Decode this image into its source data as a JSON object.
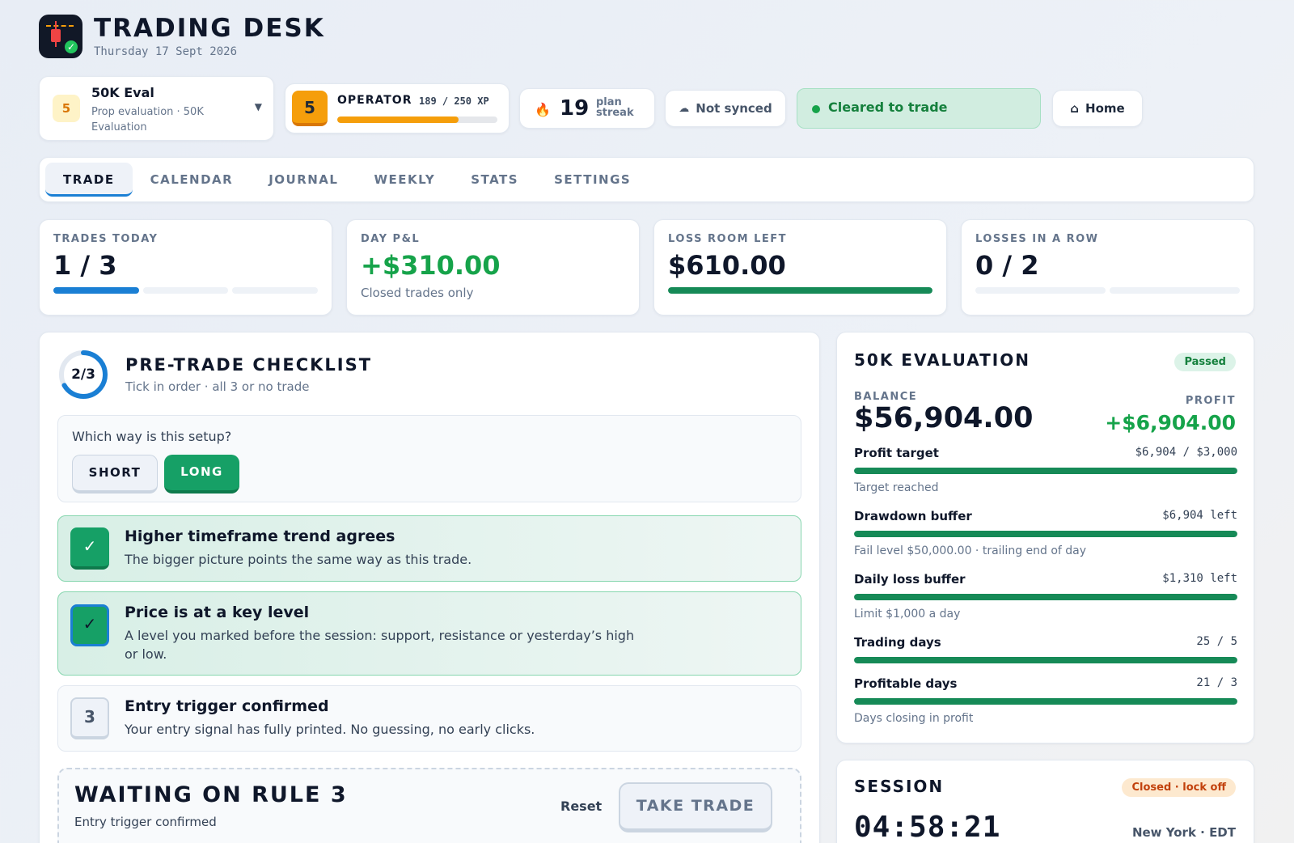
{
  "app": {
    "title": "TRADING DESK",
    "date": "Thursday 17 Sept 2026"
  },
  "account": {
    "badge": "5",
    "name": "50K Eval",
    "subtitle": "Prop evaluation · 50K Evaluation"
  },
  "operator": {
    "level": "5",
    "rank": "OPERATOR",
    "xp_text": "189 / 250 XP",
    "xp_progress": 0.756
  },
  "streak": {
    "count": "19",
    "label": "plan streak"
  },
  "sync": {
    "label": "Not synced"
  },
  "status": {
    "label": "Cleared to trade"
  },
  "home": {
    "label": "Home"
  },
  "tabs": [
    {
      "label": "TRADE",
      "active": true
    },
    {
      "label": "CALENDAR",
      "active": false
    },
    {
      "label": "JOURNAL",
      "active": false
    },
    {
      "label": "WEEKLY",
      "active": false
    },
    {
      "label": "STATS",
      "active": false
    },
    {
      "label": "SETTINGS",
      "active": false
    }
  ],
  "stats": {
    "trades_today": {
      "label": "TRADES TODAY",
      "value": "1 / 3",
      "used": 1,
      "max": 3
    },
    "day_pnl": {
      "label": "DAY P&L",
      "value": "+$310.00",
      "note": "Closed trades only"
    },
    "loss_room": {
      "label": "LOSS ROOM LEFT",
      "value": "$610.00",
      "fraction": 1.0
    },
    "losses_row": {
      "label": "LOSSES IN A ROW",
      "value": "0 / 2",
      "used": 0,
      "max": 2
    }
  },
  "checklist": {
    "progress": "2/3",
    "done": 2,
    "total": 3,
    "title": "PRE-TRADE CHECKLIST",
    "subtitle": "Tick in order · all 3 or no trade",
    "question": "Which way is this setup?",
    "short_label": "SHORT",
    "long_label": "LONG",
    "rules": [
      {
        "title": "Higher timeframe trend agrees",
        "desc": "The bigger picture points the same way as this trade."
      },
      {
        "title": "Price is at a key level",
        "desc": "A level you marked before the session: support, resistance or yesterday’s high or low."
      },
      {
        "number": "3",
        "title": "Entry trigger confirmed",
        "desc": "Your entry signal has fully printed. No guessing, no early clicks."
      }
    ],
    "waiting_title": "WAITING ON RULE 3",
    "waiting_sub": "Entry trigger confirmed",
    "reset_label": "Reset",
    "take_label": "TAKE TRADE"
  },
  "evaluation": {
    "title": "50K EVALUATION",
    "status": "Passed",
    "balance_label": "BALANCE",
    "balance": "$56,904.00",
    "profit_label": "PROFIT",
    "profit": "+$6,904.00",
    "metrics": [
      {
        "label": "Profit target",
        "value": "$6,904 / $3,000",
        "fraction": 1.0,
        "note": "Target reached"
      },
      {
        "label": "Drawdown buffer",
        "value": "$6,904 left",
        "fraction": 1.0,
        "note": "Fail level $50,000.00 · trailing end of day"
      },
      {
        "label": "Daily loss buffer",
        "value": "$1,310 left",
        "fraction": 1.0,
        "note": "Limit $1,000 a day"
      },
      {
        "label": "Trading days",
        "value": "25 / 5",
        "fraction": 1.0,
        "note": ""
      },
      {
        "label": "Profitable days",
        "value": "21 / 3",
        "fraction": 1.0,
        "note": "Days closing in profit"
      }
    ]
  },
  "session": {
    "title": "SESSION",
    "status": "Closed · lock off",
    "clock": "04:58:21",
    "timezone": "New York · EDT"
  },
  "colors": {
    "accent": "#1a7fd4",
    "success": "#16a066",
    "warning": "#f59e0b"
  }
}
